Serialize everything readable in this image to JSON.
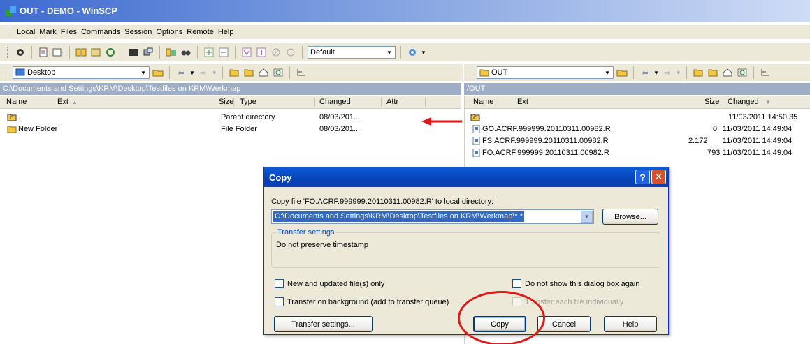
{
  "window": {
    "title": "OUT - DEMO - WinSCP"
  },
  "menu": [
    "Local",
    "Mark",
    "Files",
    "Commands",
    "Session",
    "Options",
    "Remote",
    "Help"
  ],
  "toolbar": {
    "transfer_preset": "Default"
  },
  "colors": {
    "accent": "#0a5bd6",
    "path_header": "#9eaec7",
    "annotation": "#e01818"
  },
  "left_panel": {
    "location": "Desktop",
    "path": "C:\\Documents and Settings\\KRM\\Desktop\\Testfiles on KRM\\Werkmap",
    "columns": {
      "name": "Name",
      "ext": "Ext",
      "size": "Size",
      "type": "Type",
      "changed": "Changed",
      "attr": "Attr"
    },
    "rows": [
      {
        "name": "..",
        "type": "Parent directory",
        "changed": "08/03/201..."
      },
      {
        "name": "New Folder",
        "type": "File Folder",
        "changed": "08/03/201..."
      }
    ]
  },
  "right_panel": {
    "location": "OUT",
    "path": "/OUT",
    "columns": {
      "name": "Name",
      "ext": "Ext",
      "size": "Size",
      "changed": "Changed"
    },
    "rows": [
      {
        "name": "..",
        "size": "",
        "changed": "11/03/2011 14:50:35"
      },
      {
        "name": "GO.ACRF.999999.20110311.00982.R",
        "size": "0",
        "changed": "11/03/2011 14:49:04"
      },
      {
        "name": "FS.ACRF.999999.20110311.00982.R",
        "size": "2.172",
        "changed": "11/03/2011 14:49:04"
      },
      {
        "name": "FO.ACRF.999999.20110311.00982.R",
        "size": "793",
        "changed": "11/03/2011 14:49:04"
      }
    ]
  },
  "dialog": {
    "title": "Copy",
    "help_glyph": "?",
    "close_glyph": "✕",
    "prompt": "Copy file 'FO.ACRF.999999.20110311.00982.R' to local directory:",
    "target": "C:\\Documents and Settings\\KRM\\Desktop\\Testfiles on KRM\\Werkmap\\*.*",
    "browse": "Browse...",
    "settings_legend": "Transfer settings",
    "settings_text": "Do not preserve timestamp",
    "cb_new_updated": "New and updated file(s) only",
    "cb_dont_show": "Do not show this dialog box again",
    "cb_background": "Transfer on background (add to transfer queue)",
    "cb_individually": "Transfer each file individually",
    "btn_transfer_settings": "Transfer settings...",
    "btn_copy": "Copy",
    "btn_cancel": "Cancel",
    "btn_help": "Help"
  }
}
